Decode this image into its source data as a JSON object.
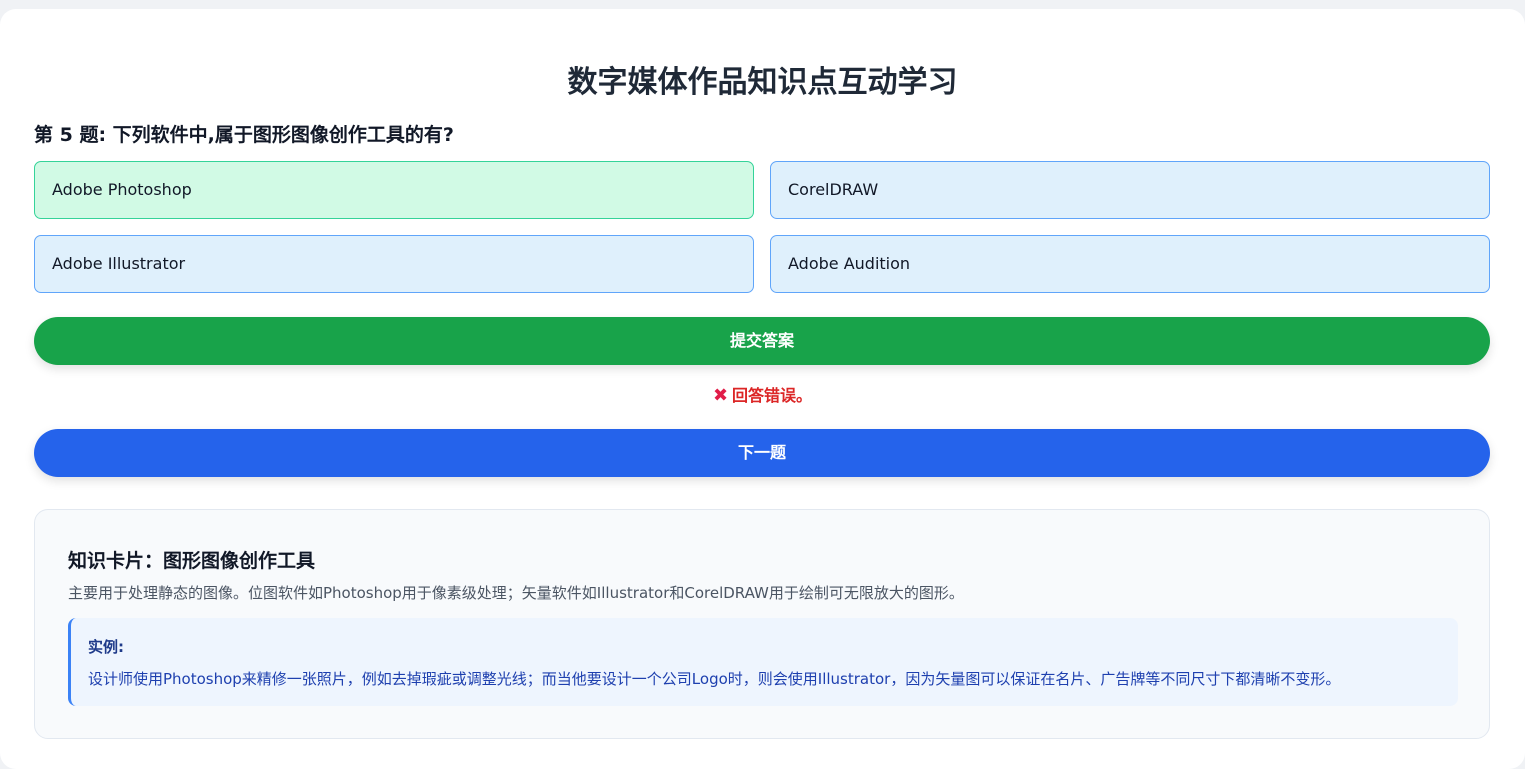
{
  "title": "数字媒体作品知识点互动学习",
  "question": "第 5 题: 下列软件中,属于图形图像创作工具的有?",
  "options": [
    {
      "label": "Adobe Photoshop",
      "selected": true
    },
    {
      "label": "CorelDRAW",
      "selected": false
    },
    {
      "label": "Adobe Illustrator",
      "selected": false
    },
    {
      "label": "Adobe Audition",
      "selected": false
    }
  ],
  "submit_label": "提交答案",
  "feedback": {
    "icon": "cross-mark-icon",
    "text": "回答错误。"
  },
  "next_label": "下一题",
  "knowledge": {
    "title": "知识卡片：图形图像创作工具",
    "description": "主要用于处理静态的图像。位图软件如Photoshop用于像素级处理；矢量软件如Illustrator和CorelDRAW用于绘制可无限放大的图形。",
    "example_label": "实例:",
    "example_text": "设计师使用Photoshop来精修一张照片，例如去掉瑕疵或调整光线；而当他要设计一个公司Logo时，则会使用Illustrator，因为矢量图可以保证在名片、广告牌等不同尺寸下都清晰不变形。"
  },
  "colors": {
    "submit": "#18a34a",
    "next": "#2563eb",
    "error": "#dc2626",
    "selected_option": "#d1fae5",
    "option": "#dff0fc"
  }
}
